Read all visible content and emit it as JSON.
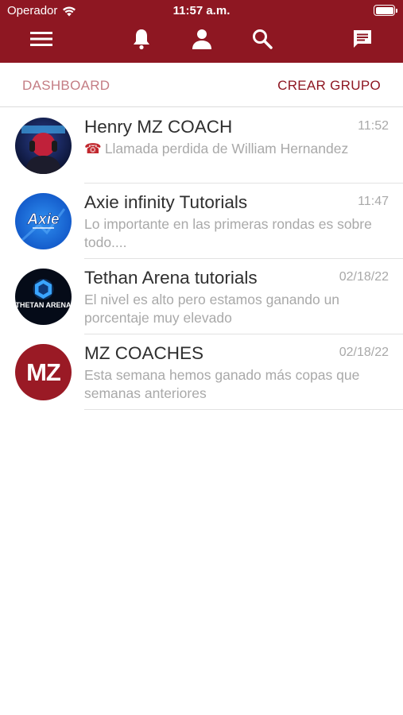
{
  "status_bar": {
    "carrier": "Operador",
    "time": "11:57 a.m."
  },
  "toolbar": {
    "icons": [
      "menu-icon",
      "bell-icon",
      "person-icon",
      "search-icon",
      "chat-icon"
    ],
    "color": "#8e1722"
  },
  "tabs": {
    "dashboard": "DASHBOARD",
    "create_group": "CREAR GRUPO"
  },
  "chats": [
    {
      "name": "Henry MZ COACH",
      "time": "11:52",
      "icon": "phone-icon",
      "message": "Llamada perdida de William Hernandez"
    },
    {
      "name": "Axie infinity Tutorials",
      "time": "11:47",
      "message": "Lo importante en las primeras rondas es sobre todo...."
    },
    {
      "name": "Tethan Arena tutorials",
      "time": "02/18/22",
      "message": "El nivel es alto pero estamos ganando un porcentaje muy elevado",
      "avatar_text": "THETAN ARENA"
    },
    {
      "name": "MZ COACHES",
      "time": "02/18/22",
      "message": "Esta semana hemos ganado más copas que semanas anteriores",
      "avatar_text": "MZ"
    }
  ],
  "avatar_labels": {
    "axie": "Axie"
  }
}
